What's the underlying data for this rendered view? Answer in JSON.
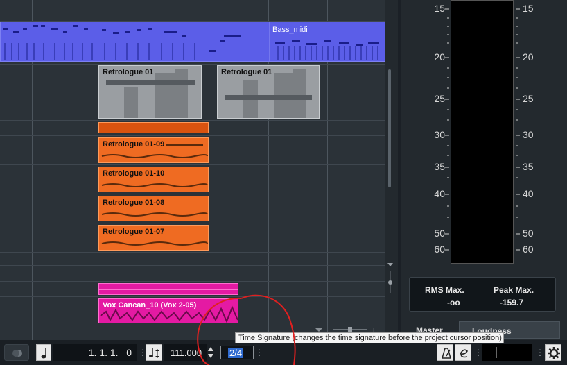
{
  "arrange": {
    "clips": {
      "bass_midi": "Bass_midi",
      "retrologue_a": "Retrologue 01",
      "retrologue_b": "Retrologue 01",
      "retro_09": "Retrologue 01-09",
      "retro_10": "Retrologue 01-10",
      "retro_08": "Retrologue 01-08",
      "retro_07": "Retrologue 01-07",
      "vox": "Vox  Cancan_10 (Vox 2-05)"
    }
  },
  "meter": {
    "left_ticks": [
      "15",
      "20",
      "25",
      "30",
      "35",
      "40",
      "50",
      "60"
    ],
    "right_ticks": [
      "15",
      "20",
      "25",
      "30",
      "35",
      "40",
      "50",
      "60"
    ],
    "rms_label": "RMS Max.",
    "rms_value": "-oo",
    "peak_label": "Peak Max.",
    "peak_value": "-159.7",
    "tab_master": "Master",
    "tab_loudness": "Loudness"
  },
  "transport": {
    "position": "1. 1. 1.   0",
    "tempo": "111.000",
    "time_signature": "2/4"
  },
  "tooltip": "Time Signature (changes the time signature before the project cursor position)",
  "colors": {
    "midi": "#5b5ee8",
    "orange": "#ef6b22",
    "pink": "#e41aa3",
    "annotation": "#e02020"
  }
}
